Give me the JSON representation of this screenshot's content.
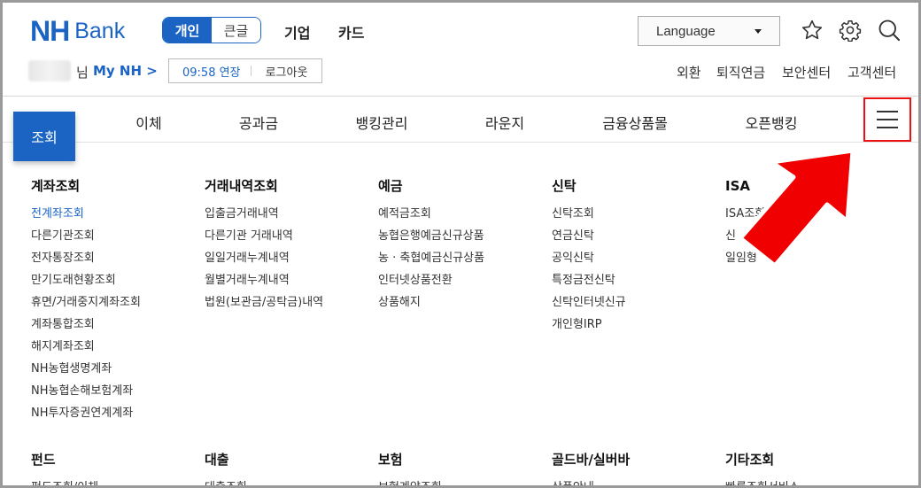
{
  "header": {
    "logo_nh": "NH",
    "logo_bank": "Bank",
    "mode": {
      "personal": "개인",
      "large_text": "큰글"
    },
    "top_links": [
      "기업",
      "카드"
    ],
    "language": "Language",
    "user_suffix": "님",
    "my_nh": "My NH >",
    "session": {
      "time": "09:58 연장",
      "logout": "로그아웃"
    },
    "util_links": [
      "외환",
      "퇴직연금",
      "보안센터",
      "고객센터"
    ]
  },
  "gnb": {
    "active": "조회",
    "items": [
      "이체",
      "공과금",
      "뱅킹관리",
      "라운지",
      "금융상품몰",
      "오픈뱅킹"
    ]
  },
  "menu": {
    "sections": [
      {
        "title": "계좌조회",
        "items": [
          "전계좌조회",
          "다른기관조회",
          "전자통장조회",
          "만기도래현황조회",
          "휴면/거래중지계좌조회",
          "계좌통합조회",
          "해지계좌조회",
          "NH농협생명계좌",
          "NH농협손해보험계좌",
          "NH투자증권연계계좌"
        ]
      },
      {
        "title": "거래내역조회",
        "items": [
          "입출금거래내역",
          "다른기관 거래내역",
          "일일거래누계내역",
          "월별거래누계내역",
          "법원(보관금/공탁금)내역"
        ]
      },
      {
        "title": "예금",
        "items": [
          "예적금조회",
          "농협은행예금신규상품",
          "농 · 축협예금신규상품",
          "인터넷상품전환",
          "상품해지"
        ]
      },
      {
        "title": "신탁",
        "items": [
          "신탁조회",
          "연금신탁",
          "공익신탁",
          "특정금전신탁",
          "신탁인터넷신규",
          "개인형IRP"
        ]
      },
      {
        "title": "ISA",
        "items": [
          "ISA조회",
          "신",
          "일임형"
        ]
      },
      {
        "title": "펀드",
        "items": [
          "펀드조회/이체"
        ]
      },
      {
        "title": "대출",
        "items": [
          "대출조회"
        ]
      },
      {
        "title": "보험",
        "items": [
          "보험계약조회"
        ]
      },
      {
        "title": "골드바/실버바",
        "items": [
          "상품안내"
        ]
      },
      {
        "title": "기타조회",
        "items": [
          "빠른조회서비스"
        ]
      }
    ]
  },
  "colors": {
    "brand": "#1b64c4",
    "highlight": "#e11111"
  }
}
